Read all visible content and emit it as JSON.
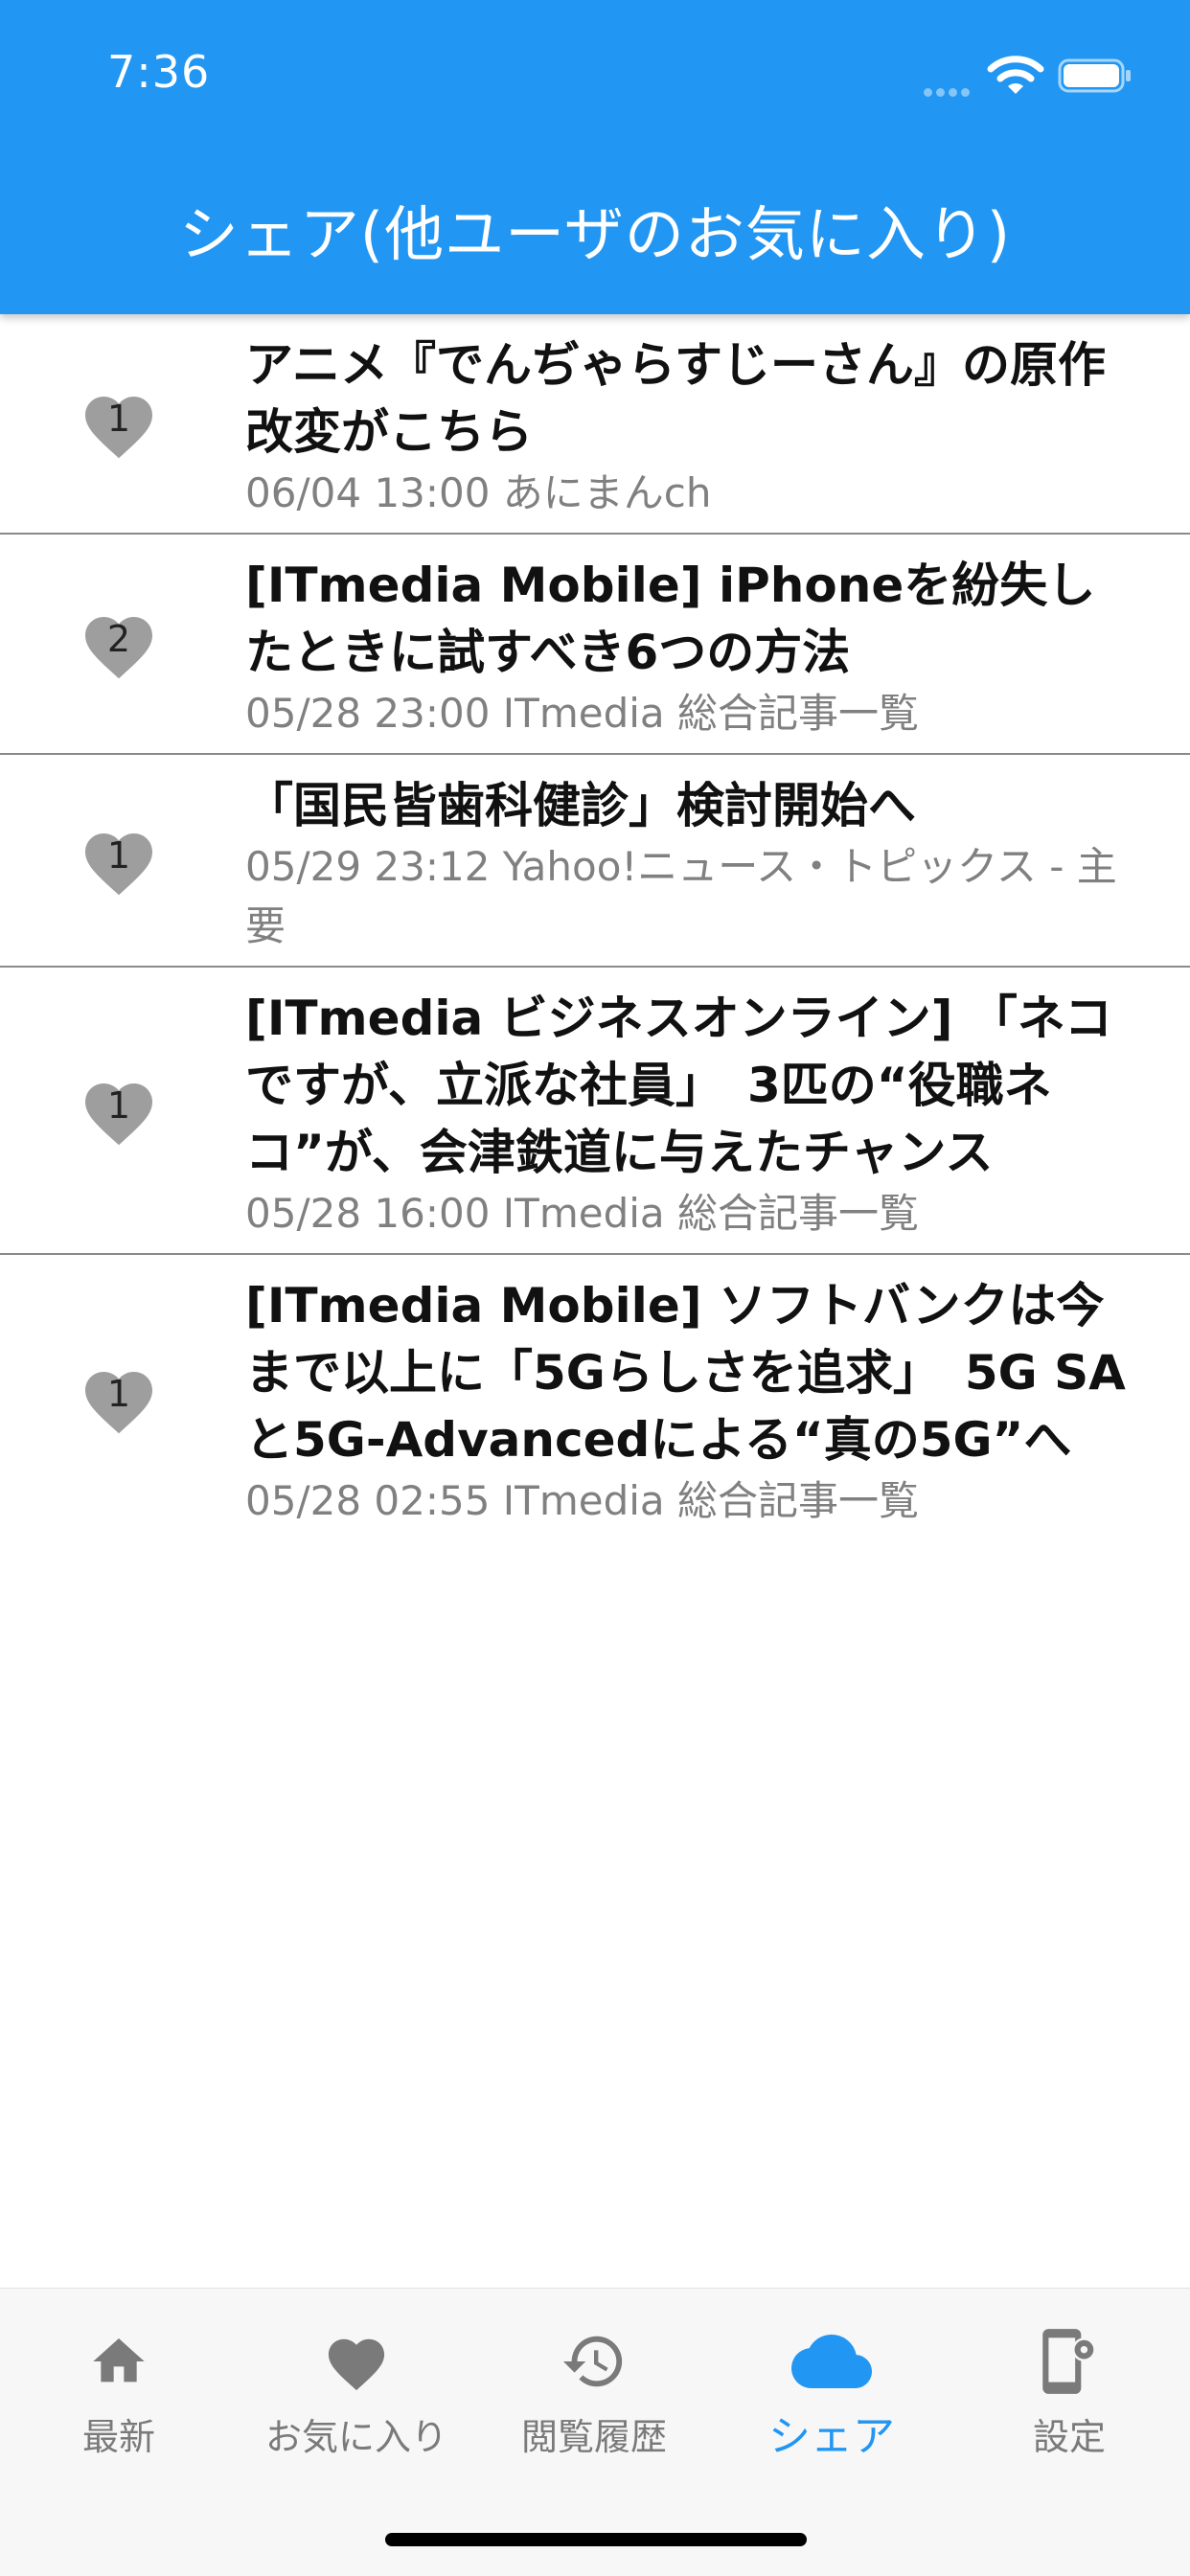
{
  "status_bar": {
    "time": "7:36"
  },
  "header": {
    "title": "シェア(他ユーザのお気に入り)"
  },
  "articles": [
    {
      "count": "1",
      "title": "アニメ『でんぢゃらすじーさん』の原作改変がこちら",
      "meta": "06/04 13:00 あにまんch"
    },
    {
      "count": "2",
      "title": "[ITmedia Mobile] iPhoneを紛失したときに試すべき6つの方法",
      "meta": "05/28 23:00 ITmedia 総合記事一覧"
    },
    {
      "count": "1",
      "title": "「国民皆歯科健診」検討開始へ",
      "meta": "05/29 23:12 Yahoo!ニュース・トピックス - 主要"
    },
    {
      "count": "1",
      "title": "[ITmedia ビジネスオンライン] 「ネコですが、立派な社員」　3匹の“役職ネコ”が、会津鉄道に与えたチャンス",
      "meta": "05/28 16:00 ITmedia 総合記事一覧"
    },
    {
      "count": "1",
      "title": "[ITmedia Mobile] ソフトバンクは今まで以上に「5Gらしさを追求」　5G SAと5G-Advancedによる“真の5G”へ",
      "meta": "05/28 02:55 ITmedia 総合記事一覧"
    }
  ],
  "tabs": [
    {
      "label": "最新",
      "icon": "home-icon"
    },
    {
      "label": "お気に入り",
      "icon": "heart-icon"
    },
    {
      "label": "閲覧履歴",
      "icon": "history-icon"
    },
    {
      "label": "シェア",
      "icon": "cloud-icon",
      "active": true
    },
    {
      "label": "設定",
      "icon": "settings-phone-icon"
    }
  ],
  "colors": {
    "accent": "#2196F3",
    "heart": "#9E9E9E",
    "meta_text": "#808080",
    "inactive_tab": "#7a7a7a"
  }
}
